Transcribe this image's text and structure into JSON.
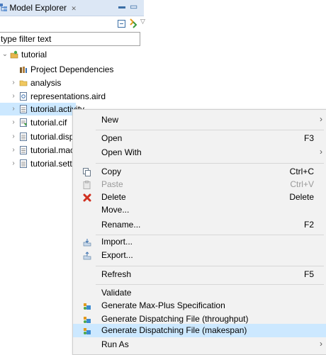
{
  "view": {
    "title": "Model Explorer",
    "close": "✕",
    "filter_placeholder": "type filter text"
  },
  "tree": [
    {
      "label": "tutorial"
    },
    {
      "label": "Project Dependencies"
    },
    {
      "label": "analysis"
    },
    {
      "label": "representations.aird"
    },
    {
      "label": "tutorial.activity"
    },
    {
      "label": "tutorial.cif"
    },
    {
      "label": "tutorial.dispa"
    },
    {
      "label": "tutorial.mach"
    },
    {
      "label": "tutorial.settir"
    }
  ],
  "menu": {
    "new": "New",
    "open": "Open",
    "open_acc": "F3",
    "open_with": "Open With",
    "copy": "Copy",
    "copy_acc": "Ctrl+C",
    "paste": "Paste",
    "paste_acc": "Ctrl+V",
    "delete": "Delete",
    "delete_acc": "Delete",
    "move": "Move...",
    "rename": "Rename...",
    "rename_acc": "F2",
    "import": "Import...",
    "export": "Export...",
    "refresh": "Refresh",
    "refresh_acc": "F5",
    "validate": "Validate",
    "gen_maxplus": "Generate Max-Plus Specification",
    "gen_throughput": "Generate Dispatching File (throughput)",
    "gen_makespan": "Generate Dispatching File (makespan)",
    "run_as": "Run As"
  },
  "colors": {
    "selection": "#cce8ff",
    "menu_bg": "#f2f2f2",
    "delete_icon": "#d03020"
  }
}
